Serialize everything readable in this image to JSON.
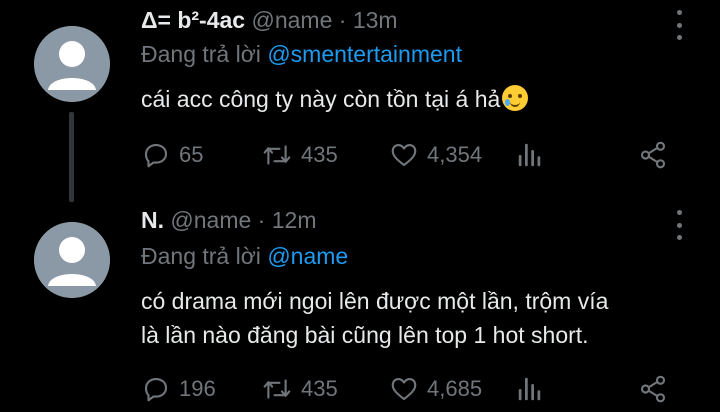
{
  "tweets": [
    {
      "display_name": "Δ= b²-4ac",
      "handle": "@name",
      "separator": "·",
      "time": "13m",
      "reply_prefix": "Đang trả lời",
      "reply_handle": "@smentertainment",
      "text": "cái acc công ty này còn tồn tại á hả",
      "emoji": "smiling-face-with-tear",
      "replies": "65",
      "retweets": "435",
      "likes": "4,354"
    },
    {
      "display_name": "N.",
      "handle": "@name",
      "separator": "·",
      "time": "12m",
      "reply_prefix": "Đang trả lời",
      "reply_handle": "@name",
      "text_line1": "có drama mới ngoi lên được một lần, trộm vía",
      "text_line2": "là lần nào đăng bài cũng lên top 1 hot short.",
      "replies": "196",
      "retweets": "435",
      "likes": "4,685"
    }
  ],
  "colors": {
    "background": "#000000",
    "primary_text": "#e7e9ea",
    "secondary_text": "#71767b",
    "link": "#1d9bf0",
    "thread_line": "#333639"
  },
  "icons": [
    "more-icon",
    "reply-icon",
    "retweet-icon",
    "like-icon",
    "views-icon",
    "share-icon"
  ]
}
